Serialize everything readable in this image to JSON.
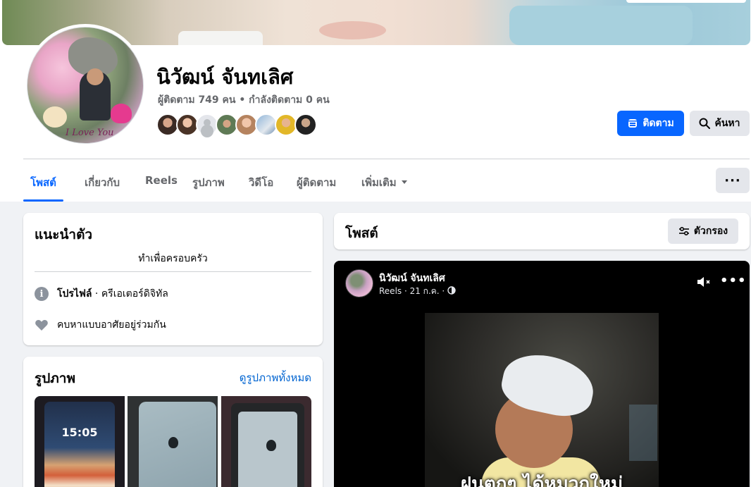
{
  "profile": {
    "name": "นิวัฒน์ จันทเลิศ",
    "follow_stats": "ผู้ติดตาม 749 คน • กำลังติดตาม 0 คน",
    "avatar_signature": "I Love You"
  },
  "actions": {
    "follow_label": "ติดตาม",
    "search_label": "ค้นหา",
    "more_label": "···"
  },
  "tabs": [
    {
      "label": "โพสต์"
    },
    {
      "label": "เกี่ยวกับ"
    },
    {
      "label": "Reels"
    },
    {
      "label": "รูปภาพ"
    },
    {
      "label": "วิดีโอ"
    },
    {
      "label": "ผู้ติดตาม"
    },
    {
      "label": "เพิ่มเติม"
    }
  ],
  "intro": {
    "title": "แนะนำตัว",
    "bio": "ทำเพื่อครอบครัว",
    "profile_label": "โปรไฟล์",
    "profile_category": " · ครีเอเตอร์ดิจิทัล",
    "relationship": "คบหาแบบอาศัยอยู่ร่วมกัน"
  },
  "photos": {
    "title": "รูปภาพ",
    "see_all": "ดูรูปภาพทั้งหมด",
    "lock_time": "15:05"
  },
  "posts": {
    "title": "โพสต์",
    "filter_label": "ตัวกรอง"
  },
  "reel_post": {
    "author": "นิวัฒน์ จันทเลิศ",
    "meta": "Reels · 21 ก.ค. · ",
    "caption": "ฝนตกๆ ได้หมวกใหม่"
  },
  "colors": {
    "accent": "#0866ff",
    "page_bg": "#f0f2f5"
  }
}
